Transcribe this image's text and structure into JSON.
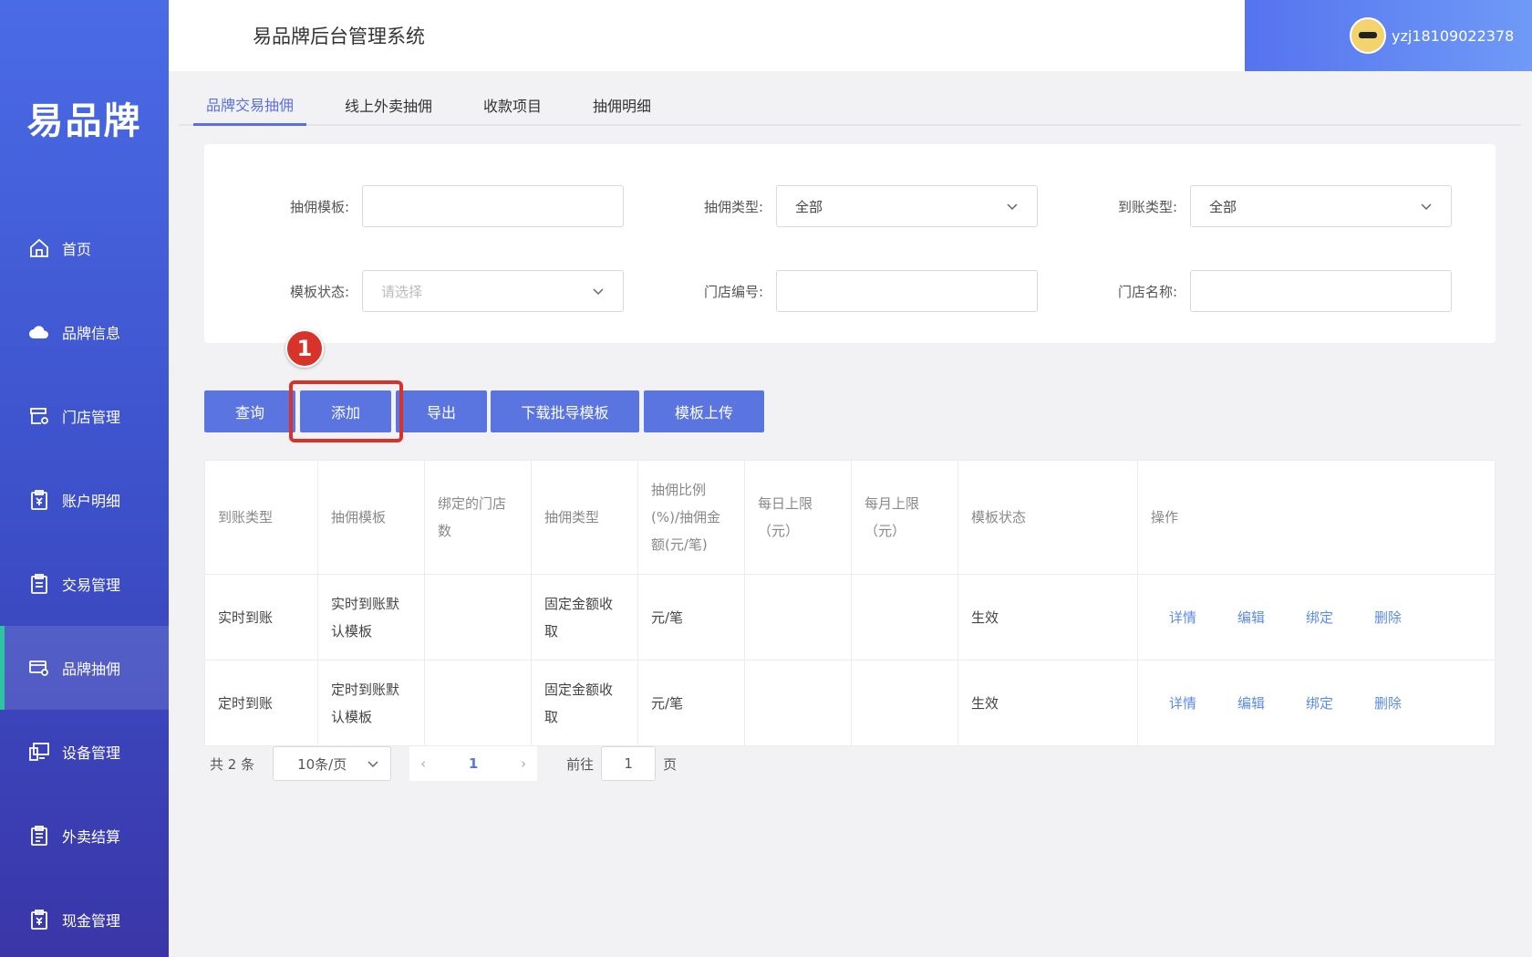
{
  "app": {
    "title": "易品牌后台管理系统",
    "logo_text": "易品牌",
    "username": "yzj18109022378"
  },
  "sidebar": {
    "items": [
      {
        "label": "首页",
        "icon": "home-icon",
        "active": false
      },
      {
        "label": "品牌信息",
        "icon": "cloud-icon",
        "active": false
      },
      {
        "label": "门店管理",
        "icon": "store-icon",
        "active": false
      },
      {
        "label": "账户明细",
        "icon": "yen-clipboard-icon",
        "active": false
      },
      {
        "label": "交易管理",
        "icon": "clipboard-icon",
        "active": false
      },
      {
        "label": "品牌抽佣",
        "icon": "card-gear-icon",
        "active": true
      },
      {
        "label": "设备管理",
        "icon": "device-icon",
        "active": false
      },
      {
        "label": "外卖结算",
        "icon": "list-icon",
        "active": false
      },
      {
        "label": "现金管理",
        "icon": "yen-clipboard-icon",
        "active": false
      }
    ]
  },
  "tabs": [
    {
      "label": "品牌交易抽佣",
      "active": true
    },
    {
      "label": "线上外卖抽佣",
      "active": false
    },
    {
      "label": "收款项目",
      "active": false
    },
    {
      "label": "抽佣明细",
      "active": false
    }
  ],
  "filters": {
    "template": {
      "label": "抽佣模板:",
      "value": ""
    },
    "commission_type": {
      "label": "抽佣类型:",
      "value": "全部"
    },
    "arrival_type": {
      "label": "到账类型:",
      "value": "全部"
    },
    "template_status": {
      "label": "模板状态:",
      "placeholder": "请选择"
    },
    "store_no": {
      "label": "门店编号:",
      "value": ""
    },
    "store_name": {
      "label": "门店名称:",
      "value": ""
    }
  },
  "buttons": {
    "query": "查询",
    "add": "添加",
    "export": "导出",
    "download_template": "下载批导模板",
    "upload_template": "模板上传"
  },
  "annotation": {
    "step": "1",
    "color": "#d8332a"
  },
  "table": {
    "headers": [
      "到账类型",
      "抽佣模板",
      "绑定的门店数",
      "抽佣类型",
      "抽佣比例(%)/抽佣金额(元/笔)",
      "每日上限（元）",
      "每月上限（元）",
      "模板状态",
      "操作"
    ],
    "rows": [
      {
        "arrival_type": "实时到账",
        "template": "实时到账默认模板",
        "store_count": "",
        "commission_type": "固定金额收取",
        "ratio": "元/笔",
        "daily_limit": "",
        "monthly_limit": "",
        "status": "生效"
      },
      {
        "arrival_type": "定时到账",
        "template": "定时到账默认模板",
        "store_count": "",
        "commission_type": "固定金额收取",
        "ratio": "元/笔",
        "daily_limit": "",
        "monthly_limit": "",
        "status": "生效"
      }
    ],
    "actions": [
      "详情",
      "编辑",
      "绑定",
      "删除"
    ]
  },
  "pagination": {
    "total_text": "共 2 条",
    "page_size": "10条/页",
    "current_page": "1",
    "goto_label": "前往",
    "goto_value": "1",
    "page_suffix": "页"
  },
  "colors": {
    "primary": "#5b75e0",
    "danger": "#d8332a",
    "sidebar_active_bar": "#2ec4a0"
  }
}
